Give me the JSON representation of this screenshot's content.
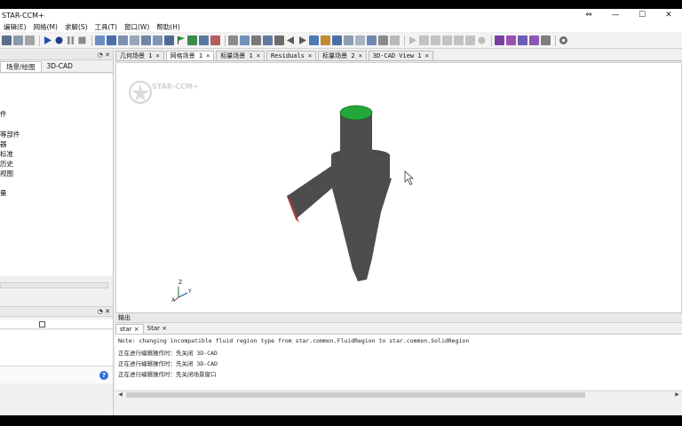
{
  "window": {
    "title": "STAR-CCM+",
    "controls": [
      "⇔",
      "—",
      "☐",
      "✕"
    ]
  },
  "menu": [
    "编辑(E)",
    "网格(M)",
    "求解(S)",
    "工具(T)",
    "窗口(W)",
    "帮助(H)"
  ],
  "left_panel": {
    "header_controls": "◔ ✕",
    "tabs": [
      "场景/绘图",
      "3D-CAD"
    ],
    "tree_items": [
      "件",
      "等部件",
      "器",
      "标准",
      "历史",
      "视图",
      "量"
    ]
  },
  "properties_panel": {
    "header_controls": "◔ ✕",
    "help_icon": "?"
  },
  "scene_tabs": [
    {
      "label": "几何场景 1",
      "active": false
    },
    {
      "label": "网格场景 1",
      "active": true
    },
    {
      "label": "标量场景 1",
      "active": false
    },
    {
      "label": "Residuals",
      "active": false
    },
    {
      "label": "标量场景 2",
      "active": false
    },
    {
      "label": "3D-CAD View 1",
      "active": false
    }
  ],
  "viewport": {
    "watermark": "STAR-CCM+",
    "triad_labels": {
      "z": "Z",
      "y": "Y",
      "x": "X"
    },
    "colors": {
      "mesh": "#3c3c3c",
      "mesh_line": "#707070",
      "outlet": "#22a83a",
      "inlet": "#b03a2e"
    }
  },
  "output": {
    "title": "输出",
    "tabs": [
      {
        "label": "star",
        "active": true
      },
      {
        "label": "Star",
        "active": false
      }
    ],
    "lines": [
      "Note: changing incompatible fluid region type from star.common.FluidRegion to star.common.SolidRegion",
      "正在进行编辑操作时：先关闭 3D-CAD",
      "正在进行编辑操作时：先关闭 3D-CAD",
      "正在进行编辑操作时：先关闭场景窗口"
    ]
  }
}
